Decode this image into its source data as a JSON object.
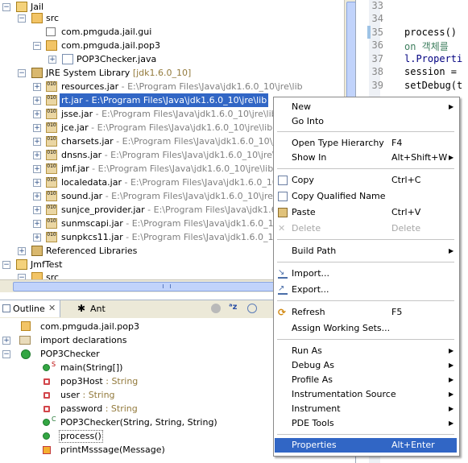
{
  "explorer": {
    "rows": [
      {
        "label": "Jail"
      },
      {
        "label": "src"
      },
      {
        "label": "com.pmguda.jail.gui"
      },
      {
        "label": "com.pmguda.jail.pop3"
      },
      {
        "label": "POP3Checker.java"
      },
      {
        "label": "JRE System Library",
        "suffix": "[jdk1.6.0_10]"
      },
      {
        "label": "resources.jar",
        "path": " - E:\\Program Files\\Java\\jdk1.6.0_10\\jre\\lib"
      },
      {
        "label": "rt.jar - E:\\Program Files\\Java\\jdk1.6.0_10\\jre\\lib"
      },
      {
        "label": "jsse.jar",
        "path": " - E:\\Program Files\\Java\\jdk1.6.0_10\\jre\\lib"
      },
      {
        "label": "jce.jar",
        "path": " - E:\\Program Files\\Java\\jdk1.6.0_10\\jre\\lib"
      },
      {
        "label": "charsets.jar",
        "path": " - E:\\Program Files\\Java\\jdk1.6.0_10\\jre\\lib"
      },
      {
        "label": "dnsns.jar",
        "path": " - E:\\Program Files\\Java\\jdk1.6.0_10\\jre\\lib\\ext"
      },
      {
        "label": "jmf.jar",
        "path": " - E:\\Program Files\\Java\\jdk1.6.0_10\\jre\\lib\\ext"
      },
      {
        "label": "localedata.jar",
        "path": " - E:\\Program Files\\Java\\jdk1.6.0_10\\jre\\"
      },
      {
        "label": "sound.jar",
        "path": " - E:\\Program Files\\Java\\jdk1.6.0_10\\jre\\lib"
      },
      {
        "label": "sunjce_provider.jar",
        "path": " - E:\\Program Files\\Java\\jdk1.6.0_"
      },
      {
        "label": "sunmscapi.jar",
        "path": " - E:\\Program Files\\Java\\jdk1.6.0_10\\jre\\"
      },
      {
        "label": "sunpkcs11.jar",
        "path": " - E:\\Program Files\\Java\\jdk1.6.0_10\\jre\\"
      },
      {
        "label": "Referenced Libraries"
      },
      {
        "label": "JmfTest"
      },
      {
        "label": "src"
      }
    ]
  },
  "editor": {
    "line_numbers": [
      "33",
      "34",
      "35",
      "36",
      "37",
      "38",
      "39"
    ],
    "code_lines": [
      "",
      "",
      "process()",
      "on 객체를 ",
      "l.Properti",
      "session = ",
      "setDebug(t"
    ]
  },
  "outline_tabs": {
    "outline": "Outline",
    "ant": "Ant"
  },
  "outline": {
    "package": "com.pmguda.jail.pop3",
    "imports": "import declarations",
    "class": "POP3Checker",
    "members": [
      {
        "name": "main(String[])",
        "type": ""
      },
      {
        "name": "pop3Host",
        "type": " : String"
      },
      {
        "name": "user",
        "type": " : String"
      },
      {
        "name": "password",
        "type": " : String"
      },
      {
        "name": "POP3Checker(String, String, String)",
        "type": ""
      },
      {
        "name": "process()",
        "type": ""
      },
      {
        "name": "printMsssage(Message)",
        "type": ""
      }
    ]
  },
  "context_menu": {
    "new": "New",
    "go_into": "Go Into",
    "open_type_hierarchy": "Open Type Hierarchy",
    "open_type_hierarchy_key": "F4",
    "show_in": "Show In",
    "show_in_key": "Alt+Shift+W",
    "copy": "Copy",
    "copy_key": "Ctrl+C",
    "copy_qualified_name": "Copy Qualified Name",
    "paste": "Paste",
    "paste_key": "Ctrl+V",
    "delete": "Delete",
    "delete_key": "Delete",
    "build_path": "Build Path",
    "import": "Import...",
    "export": "Export...",
    "refresh": "Refresh",
    "refresh_key": "F5",
    "assign_working_sets": "Assign Working Sets...",
    "run_as": "Run As",
    "debug_as": "Debug As",
    "profile_as": "Profile As",
    "instrumentation_source": "Instrumentation Source",
    "instrument": "Instrument",
    "pde_tools": "PDE Tools",
    "properties": "Properties",
    "properties_key": "Alt+Enter"
  },
  "colors": {
    "selection": "#3166c5",
    "menu_highlight": "#3166c5"
  }
}
